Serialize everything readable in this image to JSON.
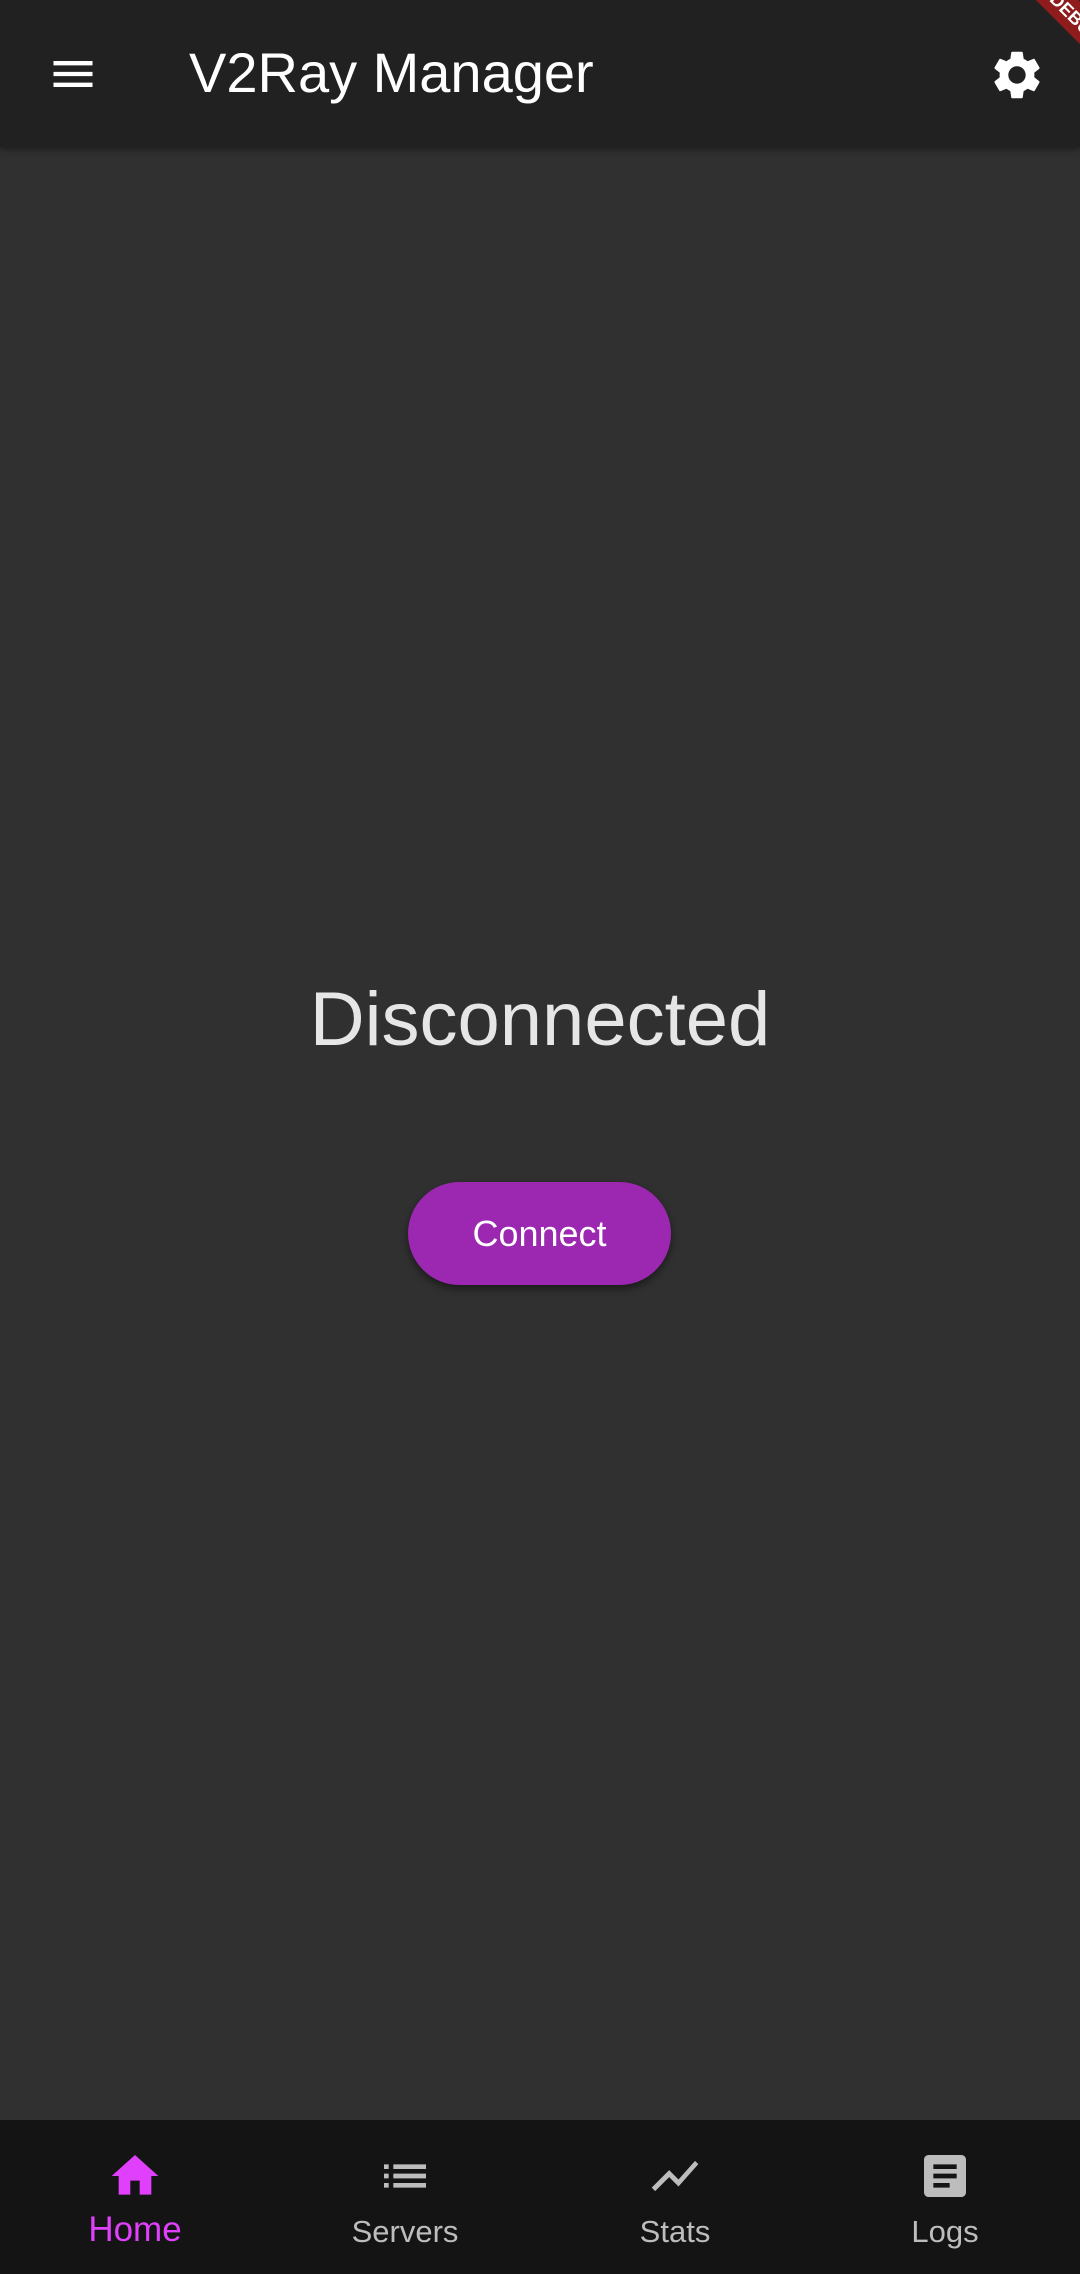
{
  "appbar": {
    "title": "V2Ray Manager",
    "menu_icon": "menu-icon",
    "settings_icon": "gear-icon",
    "debug_ribbon": "DEBUG"
  },
  "main": {
    "status": "Disconnected",
    "connect_label": "Connect"
  },
  "bottom_nav": {
    "items": [
      {
        "label": "Home",
        "icon": "home-icon",
        "active": true
      },
      {
        "label": "Servers",
        "icon": "list-icon",
        "active": false
      },
      {
        "label": "Stats",
        "icon": "trending-icon",
        "active": false
      },
      {
        "label": "Logs",
        "icon": "document-icon",
        "active": false
      }
    ]
  },
  "colors": {
    "appbar_bg": "#212121",
    "body_bg": "#303030",
    "accent": "#9c27b0",
    "nav_active": "#e040fb",
    "nav_bg": "#141414"
  }
}
